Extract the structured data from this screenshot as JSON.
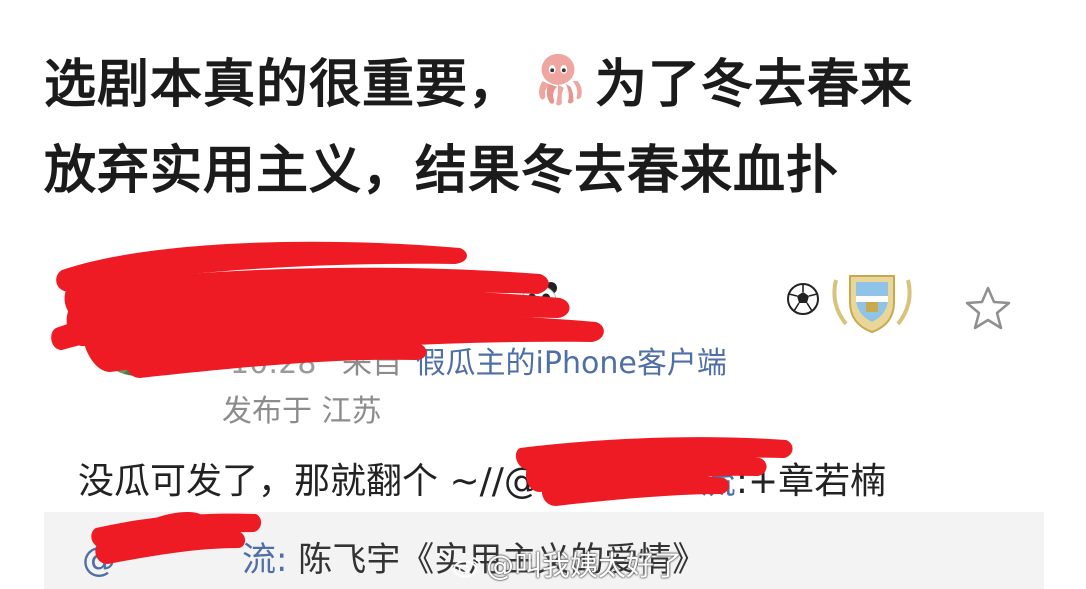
{
  "caption": {
    "line1_before": "选剧本真的很重要，",
    "line1_emoji": "octopus",
    "line1_after": "为了冬去春来",
    "line2": "放弃实用主义，结果冬去春来血扑"
  },
  "post": {
    "time": "10:28",
    "from_label": "来自",
    "client": "假瓜主的iPhone客户端",
    "location": "发布于 江苏",
    "text_before": "没瓜可发了，那就翻个 ~//@",
    "text_link_tail": "流",
    "text_after": ":+章若楠"
  },
  "repost": {
    "prefix": "@",
    "user_tail": "流",
    "colon": ": ",
    "content": "陈飞宇《实用主义的爱情》"
  },
  "watermark": {
    "text": "@叫我姨太好了"
  },
  "icons": {
    "octopus": "octopus-emoji-icon",
    "panda": "panda-badge-icon",
    "football": "football-icon",
    "team": "team-badge-icon",
    "star": "star-icon",
    "weibo": "weibo-logo-icon"
  },
  "colors": {
    "link": "#4f6fa6",
    "meta": "#8c8c8c",
    "redaction": "#ee1b24",
    "repost_bg": "#f3f3f3"
  }
}
